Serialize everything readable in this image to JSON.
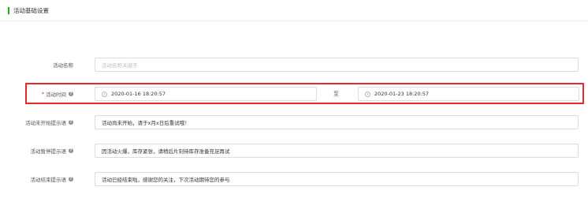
{
  "section": {
    "title": "活动基础设置"
  },
  "form": {
    "activity_name": {
      "label": "活动名称",
      "placeholder": "活动名称关键字",
      "value": ""
    },
    "activity_time": {
      "label": "活动时间",
      "required_mark": "*",
      "start": "2020-01-16 18:20:57",
      "separator": "至",
      "end": "2020-01-23 18:20:57"
    },
    "not_started_msg": {
      "label": "活动未开始提示语",
      "value": "活动尚未开始，请于x月x日后重试哦！"
    },
    "paused_msg": {
      "label": "活动暂停提示语",
      "value": "因活动火爆，库存紧张，请稍后片刻待库存准备充足再试"
    },
    "ended_msg": {
      "label": "活动结束提示语",
      "value": "活动已经结束啦，感谢您的关注，下次活动期待您的参与"
    }
  },
  "colors": {
    "accent": "#1ab01a",
    "highlight": "#e62a2a"
  },
  "icons": {
    "help": "question-circle-icon",
    "time": "clock-icon"
  }
}
